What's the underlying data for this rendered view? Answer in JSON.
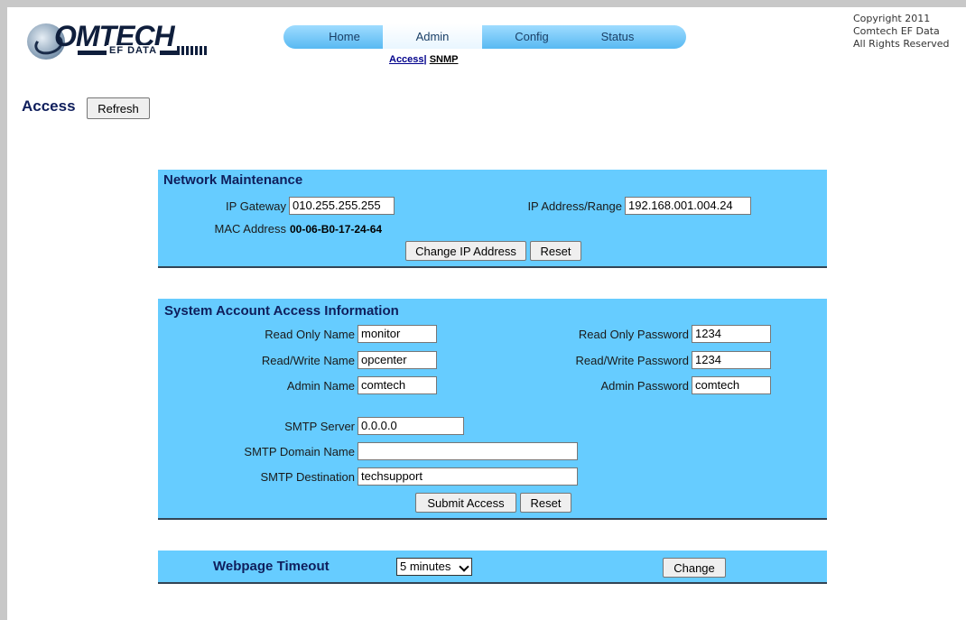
{
  "header": {
    "logo_text": "OMTECH",
    "logo_sub": "EF DATA",
    "copyright": [
      "Copyright 2011",
      "Comtech EF Data",
      "All Rights Reserved"
    ]
  },
  "nav": {
    "tabs": [
      "Home",
      "Admin",
      "Config",
      "Status"
    ],
    "active": "Admin",
    "subnav": {
      "access": "Access|",
      "snmp": "SNMP"
    }
  },
  "page": {
    "title": "Access",
    "refresh_label": "Refresh"
  },
  "network": {
    "title": "Network Maintenance",
    "ip_gateway_label": "IP Gateway",
    "ip_gateway_value": "010.255.255.255",
    "ip_range_label": "IP Address/Range",
    "ip_range_value": "192.168.001.004.24",
    "mac_label": "MAC Address",
    "mac_value": "00-06-B0-17-24-64",
    "change_label": "Change IP Address",
    "reset_label": "Reset"
  },
  "account": {
    "title": "System Account Access Information",
    "ro_name_label": "Read Only Name",
    "ro_name_value": "monitor",
    "rw_name_label": "Read/Write Name",
    "rw_name_value": "opcenter",
    "admin_name_label": "Admin Name",
    "admin_name_value": "comtech",
    "ro_pw_label": "Read Only Password",
    "ro_pw_value": "1234",
    "rw_pw_label": "Read/Write Password",
    "rw_pw_value": "1234",
    "admin_pw_label": "Admin Password",
    "admin_pw_value": "comtech",
    "smtp_server_label": "SMTP Server",
    "smtp_server_value": "0.0.0.0",
    "smtp_domain_label": "SMTP Domain Name",
    "smtp_domain_value": "",
    "smtp_dest_label": "SMTP Destination",
    "smtp_dest_value": "techsupport",
    "submit_label": "Submit Access",
    "reset_label": "Reset"
  },
  "timeout": {
    "title": "Webpage Timeout",
    "selected": "5 minutes",
    "change_label": "Change"
  },
  "colors": {
    "panel": "#66ccff",
    "title": "#0f1e5c",
    "nav": "#58b9f2"
  }
}
